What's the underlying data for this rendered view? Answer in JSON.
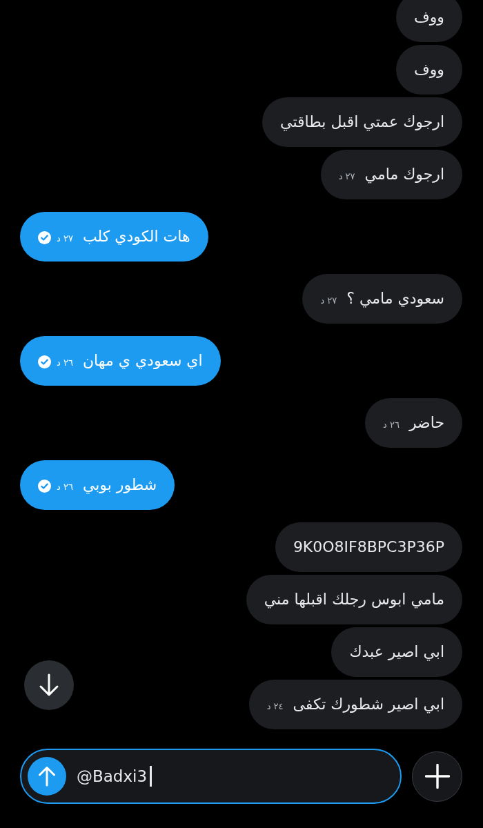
{
  "messages": [
    {
      "kind": "received",
      "text": "ووف"
    },
    {
      "kind": "received",
      "text": "ووف"
    },
    {
      "kind": "received",
      "text": "ارجوك عمتي اقبل بطاقتي"
    },
    {
      "kind": "received",
      "text": "ارجوك مامي",
      "time": "٢٧ د"
    },
    {
      "kind": "sent",
      "text": "هات الكودي كلب",
      "time": "٢٧ د",
      "read": true
    },
    {
      "kind": "received",
      "text": "سعودي مامي ؟",
      "time": "٢٧ د"
    },
    {
      "kind": "sent",
      "text": "اي سعودي ي مهان",
      "time": "٢٦ د",
      "read": true
    },
    {
      "kind": "received",
      "text": "حاضر",
      "time": "٢٦ د"
    },
    {
      "kind": "sent",
      "text": "شطور بوبي",
      "time": "٢٦ د",
      "read": true
    },
    {
      "kind": "received",
      "text": "9K0O8IF8BPC3P36P"
    },
    {
      "kind": "received",
      "text": "مامي ابوس رجلك اقبلها مني"
    },
    {
      "kind": "received",
      "text": "ابي اصير عبدك"
    },
    {
      "kind": "received",
      "text": "ابي اصير شطورك تكفى",
      "time": "٢٤ د"
    }
  ],
  "composer": {
    "value": "@Badxi3",
    "focused": true
  }
}
